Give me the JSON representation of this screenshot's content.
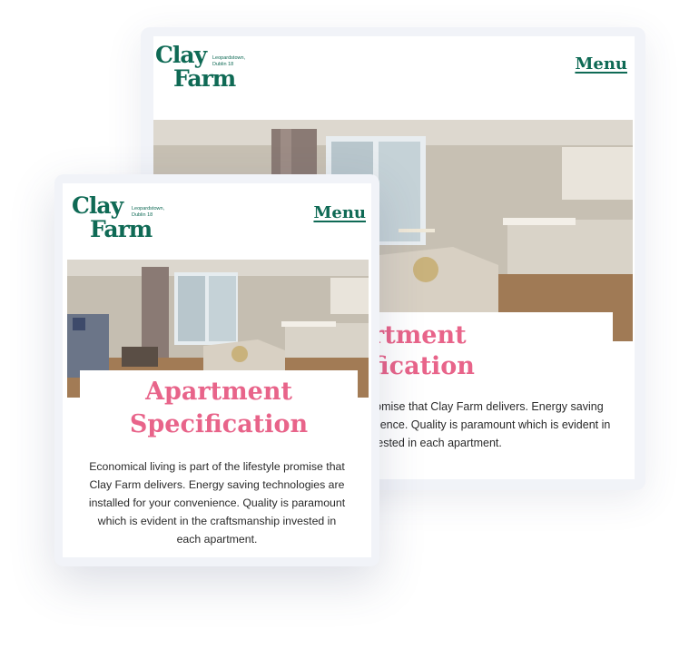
{
  "brand": {
    "logo_line1": "Clay",
    "logo_line2": "Farm",
    "location_line1": "Leopardstown,",
    "location_line2": "Dublin 18",
    "green": "#0f6a55",
    "pink": "#e8648a"
  },
  "nav": {
    "menu_label": "Menu"
  },
  "hero": {
    "image_icon": "apartment-interior-photo",
    "title_line1": "Apartment",
    "title_line2": "Specification",
    "back_title_line1": "rtment",
    "back_title_line2": "fication"
  },
  "content": {
    "front_lines": [
      "Economical living is part of the lifestyle promise that",
      "Clay Farm delivers. Energy saving technologies are",
      "installed for your convenience. Quality is paramount",
      "which is evident in the craftsmanship invested in",
      "each apartment."
    ],
    "back_lines": [
      "romise that Clay Farm delivers. Energy saving",
      "nience. Quality is paramount which is evident in",
      "vested in each apartment."
    ]
  }
}
